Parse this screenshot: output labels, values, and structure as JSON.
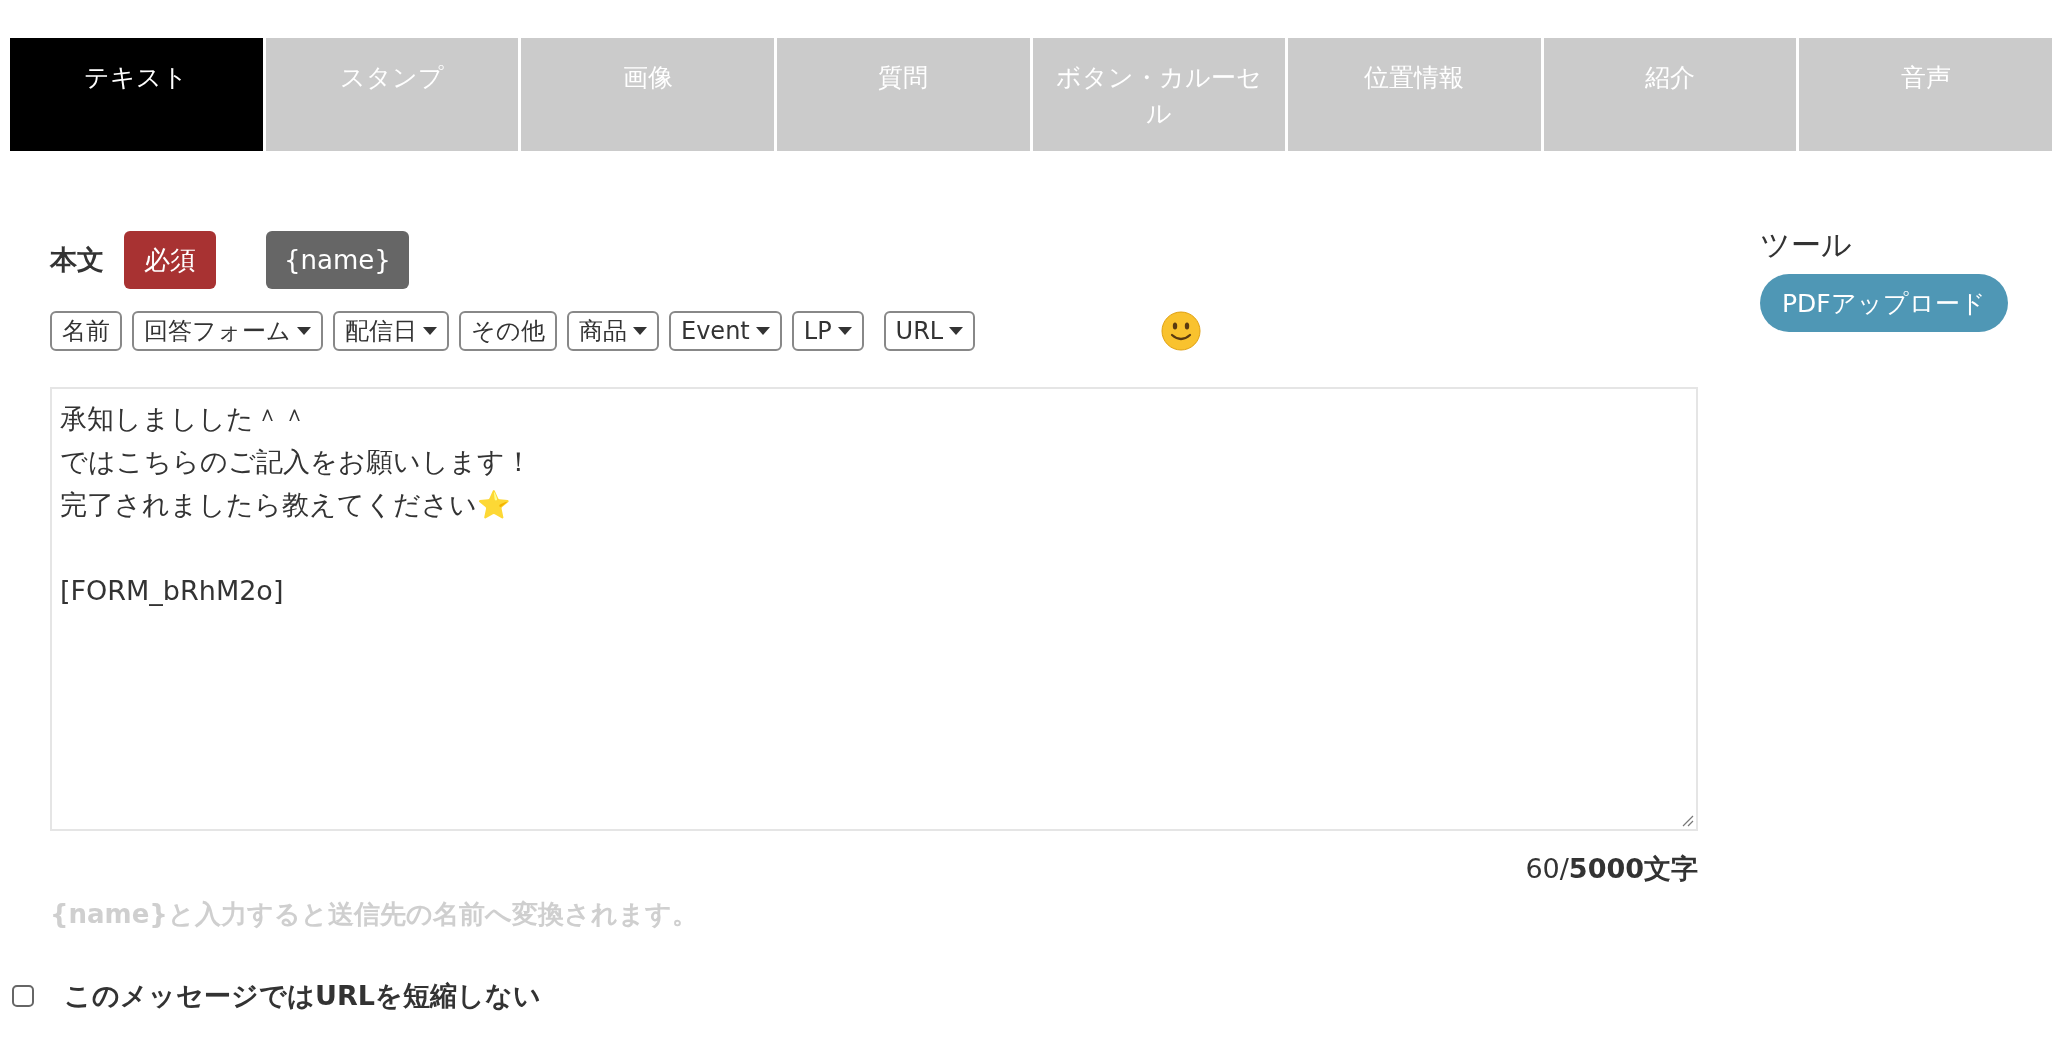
{
  "tabs": [
    {
      "label": "テキスト",
      "selected": true
    },
    {
      "label": "スタンプ",
      "selected": false
    },
    {
      "label": "画像",
      "selected": false
    },
    {
      "label": "質問",
      "selected": false
    },
    {
      "label": "ボタン・カルーセル",
      "selected": false
    },
    {
      "label": "位置情報",
      "selected": false
    },
    {
      "label": "紹介",
      "selected": false
    },
    {
      "label": "音声",
      "selected": false
    }
  ],
  "body": {
    "label": "本文",
    "required_badge": "必須",
    "name_button": "{name}",
    "insert_buttons": [
      {
        "label": "名前",
        "dropdown": false
      },
      {
        "label": "回答フォーム",
        "dropdown": true
      },
      {
        "label": "配信日",
        "dropdown": true
      },
      {
        "label": "その他",
        "dropdown": false
      },
      {
        "label": "商品",
        "dropdown": true
      },
      {
        "label": "Event",
        "dropdown": true
      },
      {
        "label": "LP",
        "dropdown": true
      },
      {
        "label": "URL",
        "dropdown": true
      }
    ],
    "message_paragraphs": [
      {
        "lines": [
          "承知しましした＾＾",
          "ではこちらのご記入をお願いします！",
          "完了されましたら教えてください⭐"
        ]
      },
      {
        "lines": [
          "[FORM_bRhM2o]"
        ]
      }
    ],
    "counter": "60/**5000文字**",
    "hint": "{name}と入力すると送信先の名前へ変換されます。"
  },
  "tools": {
    "title": "ツール",
    "pdf_button": "PDFアップロード"
  },
  "shorten_option": {
    "label": "このメッセージではURLを短縮しない",
    "checked": false
  }
}
